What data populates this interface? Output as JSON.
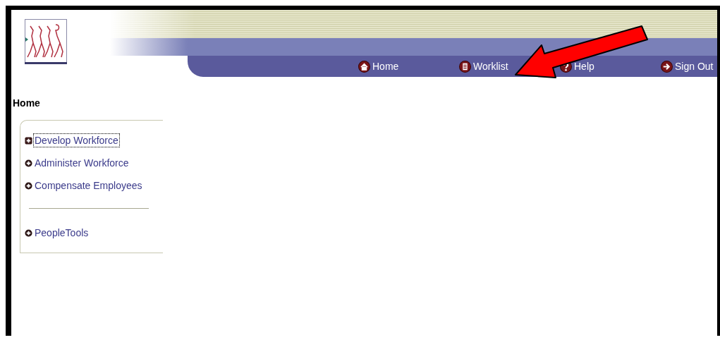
{
  "nav": [
    {
      "kind": "home",
      "label": "Home"
    },
    {
      "kind": "worklist",
      "label": "Worklist"
    },
    {
      "kind": "help",
      "label": "Help"
    },
    {
      "kind": "signout",
      "label": "Sign Out"
    }
  ],
  "page_title": "Home",
  "menu_groups": [
    [
      {
        "label": "Develop Workforce",
        "focused": true
      },
      {
        "label": "Administer Workforce",
        "focused": false
      },
      {
        "label": "Compensate Employees",
        "focused": false
      }
    ],
    [
      {
        "label": "PeopleTools",
        "focused": false
      }
    ]
  ]
}
